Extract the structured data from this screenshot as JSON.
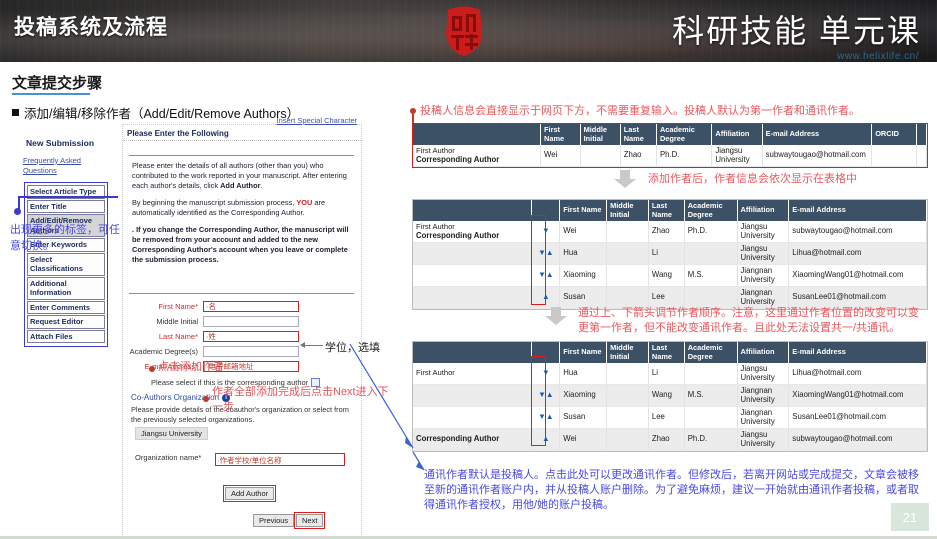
{
  "header": {
    "title_left": "投稿系统及流程",
    "title_right": "科研技能 单元课",
    "url": "www.helixlife.cn/",
    "seal_name": "red-seal-stamp"
  },
  "slide": {
    "title": "文章提交步骤",
    "bullet": "添加/编辑/移除作者（Add/Edit/Remove Authors）",
    "page_number": "21"
  },
  "left_panel": {
    "heading": "New Submission",
    "faq_link": "Frequently Asked Questions",
    "nav_items": [
      {
        "label": "Select Article Type",
        "active": false
      },
      {
        "label": "Enter Title",
        "active": false
      },
      {
        "label": "Add/Edit/Remove Authors",
        "active": true
      },
      {
        "label": "Enter Keywords",
        "active": false
      },
      {
        "label": "Select Classifications",
        "active": false
      },
      {
        "label": "Additional Information",
        "active": false
      },
      {
        "label": "Enter Comments",
        "active": false
      },
      {
        "label": "Request Editor",
        "active": false
      },
      {
        "label": "Attach Files",
        "active": false
      }
    ],
    "note": "出现更多的标签，可任意切换。"
  },
  "form": {
    "insert_special_character": "Insert Special Character",
    "panel_header": "Please Enter the Following",
    "para1_pre": "Please enter the details of all authors (other than you) who contributed to the work reported in your manuscript. After entering each author's details, click ",
    "para1_bold": "Add Author",
    "para1_post": ".",
    "para2_pre": "By beginning the manuscript submission process, ",
    "para2_red": "YOU",
    "para2_post": " are automatically identified as the Corresponding Author.",
    "para3": ". If you change the Corresponding Author, the manuscript will be removed from your account and added to the new Corresponding Author's account when you leave or complete the submission process.",
    "fields": [
      {
        "label": "First Name*",
        "value": "·名",
        "required": true,
        "highlight": true
      },
      {
        "label": "Middle Initial",
        "value": "",
        "required": false,
        "highlight": false
      },
      {
        "label": "Last Name*",
        "value": "·姓",
        "required": true,
        "highlight": true
      },
      {
        "label": "Academic Degree(s)",
        "value": "",
        "required": false,
        "highlight": false
      },
      {
        "label": "E-mail Address*",
        "value": "·电子邮箱地址",
        "required": true,
        "highlight": true
      }
    ],
    "degree_note": "学位，选填",
    "corresponding_checkbox_label": "Please select if this is the corresponding author",
    "co_org_title": "Co-Authors Organization",
    "co_org_info_icon": "info-icon",
    "co_org_desc": "Please provide details of the coauthor's organization or select from the previously selected organizations.",
    "org_chip": "Jiangsu University",
    "org_name_label": "Organization name*",
    "org_name_value": "·作者学校/单位名称",
    "add_author_button": "Add Author",
    "add_author_note": "点击添加作者",
    "previous_button": "Previous",
    "next_button": "Next",
    "next_note": "作者全部添加完成后点击Next进入下一步"
  },
  "annotations": {
    "top": "投稿人信息会直接显示于网页下方，不需要重复输入。投稿人默认为第一作者和通讯作者。",
    "mid1": "添加作者后，作者信息会依次显示在表格中",
    "mid2": "通过上、下箭头调节作者顺序。注意，这里通过作者位置的改变可以变更第一作者，但不能改变通讯作者。且此处无法设置共一/共通讯。",
    "bottom": "通讯作者默认是投稿人。点击此处可以更改通讯作者。但修改后，若离开网站或完成提交，文章会被移至新的通讯作者账户内，并从投稿人账户删除。为了避免麻烦，建议一开始就由通讯作者投稿，或者取得通讯作者授权，用他/她的账户投稿。"
  },
  "table1": {
    "headers": [
      "",
      "First Name",
      "Middle Initial",
      "Last Name",
      "Academic Degree",
      "Affiliation",
      "E-mail Address",
      "ORCID",
      ""
    ],
    "rows": [
      {
        "role_line1": "First Author",
        "role_line2": "Corresponding Author",
        "first_name": "Wei",
        "middle_initial": "",
        "last_name": "Zhao",
        "degree": "Ph.D.",
        "affiliation": "Jiangsu University",
        "email": "subwaytougao@hotmail.com",
        "orcid": ""
      }
    ]
  },
  "table2": {
    "headers": [
      "",
      "",
      "First Name",
      "Middle Initial",
      "Last Name",
      "Academic Degree",
      "Affiliation",
      "E-mail Address"
    ],
    "rows": [
      {
        "role_line1": "First Author",
        "role_line2": "Corresponding Author",
        "down": true,
        "up": false,
        "first_name": "Wei",
        "middle_initial": "",
        "last_name": "Zhao",
        "degree": "Ph.D.",
        "affiliation": "Jiangsu University",
        "email": "subwaytougao@hotmail.com"
      },
      {
        "role_line1": "",
        "role_line2": "",
        "down": true,
        "up": true,
        "first_name": "Hua",
        "middle_initial": "",
        "last_name": "Li",
        "degree": "",
        "affiliation": "Jiangsu University",
        "email": "Lihua@hotmail.com"
      },
      {
        "role_line1": "",
        "role_line2": "",
        "down": true,
        "up": true,
        "first_name": "Xiaoming",
        "middle_initial": "",
        "last_name": "Wang",
        "degree": "M.S.",
        "affiliation": "Jiangnan University",
        "email": "XiaomingWang01@hotmail.com"
      },
      {
        "role_line1": "",
        "role_line2": "",
        "down": false,
        "up": true,
        "first_name": "Susan",
        "middle_initial": "",
        "last_name": "Lee",
        "degree": "",
        "affiliation": "Jiangnan University",
        "email": "SusanLee01@hotmail.com"
      }
    ]
  },
  "table3": {
    "headers": [
      "",
      "",
      "First Name",
      "Middle Initial",
      "Last Name",
      "Academic Degree",
      "Affiliation",
      "E-mail Address"
    ],
    "rows": [
      {
        "role_line1": "First Author",
        "role_line2": "",
        "down": true,
        "up": false,
        "first_name": "Hua",
        "middle_initial": "",
        "last_name": "Li",
        "degree": "",
        "affiliation": "Jiangsu University",
        "email": "Lihua@hotmail.com"
      },
      {
        "role_line1": "",
        "role_line2": "",
        "down": true,
        "up": true,
        "first_name": "Xiaoming",
        "middle_initial": "",
        "last_name": "Wang",
        "degree": "M.S.",
        "affiliation": "Jiangnan University",
        "email": "XiaomingWang01@hotmail.com"
      },
      {
        "role_line1": "",
        "role_line2": "",
        "down": true,
        "up": true,
        "first_name": "Susan",
        "middle_initial": "",
        "last_name": "Lee",
        "degree": "",
        "affiliation": "Jiangnan University",
        "email": "SusanLee01@hotmail.com"
      },
      {
        "role_line1": "",
        "role_line2": "Corresponding Author",
        "down": false,
        "up": true,
        "first_name": "Wei",
        "middle_initial": "",
        "last_name": "Zhao",
        "degree": "Ph.D.",
        "affiliation": "Jiangsu University",
        "email": "subwaytougao@hotmail.com"
      }
    ]
  },
  "colors": {
    "header_bg": "#1d1d1f",
    "table_header_bg": "#3d5166",
    "highlight_red": "#e01b1b",
    "annotation_red": "#e8595e",
    "annotation_blue": "#4a4ae0",
    "accent_blue": "#4a90d9"
  }
}
